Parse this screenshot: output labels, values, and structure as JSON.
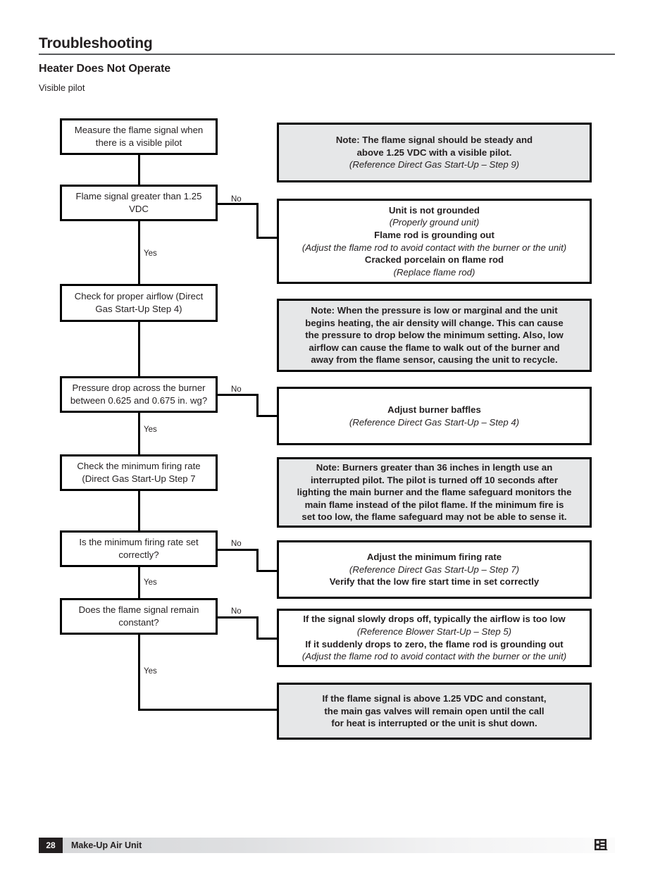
{
  "document": {
    "page_title": "Troubleshooting",
    "section_title": "Heater Does Not Operate",
    "section_subtitle": "Visible pilot"
  },
  "flowchart": {
    "type": "decision-flowchart",
    "edge_labels": {
      "yes": "Yes",
      "no": "No"
    },
    "left_nodes": [
      {
        "id": "measure-flame-signal",
        "kind": "process",
        "lines": [
          "Measure the flame signal",
          "when there is a visible pilot"
        ]
      },
      {
        "id": "flame-signal-greater",
        "kind": "decision",
        "lines": [
          "Flame signal greater",
          "than 1.25 VDC"
        ]
      },
      {
        "id": "check-proper-airflow",
        "kind": "process",
        "lines": [
          "Check for proper airflow",
          "(Direct Gas Start-Up Step 4)"
        ]
      },
      {
        "id": "pressure-drop-across-burner",
        "kind": "decision",
        "lines": [
          "Pressure drop across the burner",
          "between 0.625 and 0.675 in. wg?"
        ]
      },
      {
        "id": "check-minimum-firing-rate",
        "kind": "process",
        "lines": [
          "Check the minimum firing rate",
          "(Direct Gas Start-Up Step 7"
        ]
      },
      {
        "id": "is-minimum-firing-rate-set",
        "kind": "decision",
        "lines": [
          "Is the minimum firing rate",
          "set correctly?"
        ]
      },
      {
        "id": "does-flame-signal-remain-constant",
        "kind": "decision",
        "lines": [
          "Does the flame signal",
          "remain constant?"
        ]
      }
    ],
    "right_nodes": [
      {
        "id": "note-flame-signal-steady",
        "style": "note",
        "lines": [
          {
            "text": "Note: The flame signal should be steady and",
            "emphasis": "bold"
          },
          {
            "text": "above 1.25 VDC with a visible pilot.",
            "emphasis": "bold"
          },
          {
            "text": "(Reference Direct Gas Start-Up – Step 9)",
            "emphasis": "italic"
          }
        ]
      },
      {
        "id": "action-grounding-causes",
        "style": "action",
        "lines": [
          {
            "text": "Unit is not grounded",
            "emphasis": "bold"
          },
          {
            "text": "(Properly ground unit)",
            "emphasis": "italic"
          },
          {
            "text": "Flame rod is grounding out",
            "emphasis": "bold"
          },
          {
            "text": "(Adjust the flame rod to avoid contact with the burner or the unit)",
            "emphasis": "italic"
          },
          {
            "text": "Cracked porcelain on flame rod",
            "emphasis": "bold"
          },
          {
            "text": "(Replace flame rod)",
            "emphasis": "italic"
          }
        ]
      },
      {
        "id": "note-pressure-low-marginal",
        "style": "note",
        "lines": [
          {
            "text": "Note: When the pressure is low or marginal and the unit",
            "emphasis": "bold"
          },
          {
            "text": "begins heating, the air density will change. This can cause",
            "emphasis": "bold"
          },
          {
            "text": "the pressure to drop below the minimum setting. Also, low",
            "emphasis": "bold"
          },
          {
            "text": "airflow can cause the flame to walk out of the burner and",
            "emphasis": "bold"
          },
          {
            "text": "away from the flame sensor, causing the unit to recycle.",
            "emphasis": "bold"
          }
        ]
      },
      {
        "id": "action-adjust-burner-baffles",
        "style": "action",
        "lines": [
          {
            "text": "Adjust burner baffles",
            "emphasis": "bold"
          },
          {
            "text": "(Reference Direct Gas Start-Up – Step 4)",
            "emphasis": "italic"
          }
        ]
      },
      {
        "id": "note-burners-greater-36-inches",
        "style": "note",
        "lines": [
          {
            "text": "Note: Burners greater than 36 inches in length use an",
            "emphasis": "bold"
          },
          {
            "text": "interrupted pilot. The pilot is turned off 10 seconds after",
            "emphasis": "bold"
          },
          {
            "text": "lighting the main burner and the flame safeguard monitors the",
            "emphasis": "bold"
          },
          {
            "text": "main flame instead of the pilot flame. If the minimum fire is",
            "emphasis": "bold"
          },
          {
            "text": "set too low, the flame safeguard may not be able to sense it.",
            "emphasis": "bold"
          }
        ]
      },
      {
        "id": "action-adjust-minimum-firing-rate",
        "style": "action",
        "lines": [
          {
            "text": "Adjust the minimum firing rate",
            "emphasis": "bold"
          },
          {
            "text": "(Reference Direct Gas Start-Up – Step 7)",
            "emphasis": "italic"
          },
          {
            "text": "Verify that the low fire start time in set correctly",
            "emphasis": "bold"
          }
        ]
      },
      {
        "id": "action-signal-drop-diagnosis",
        "style": "action",
        "lines": [
          {
            "text": "If the signal slowly drops off, typically the airflow is too low",
            "emphasis": "bold"
          },
          {
            "text": "(Reference Blower Start-Up – Step 5)",
            "emphasis": "italic"
          },
          {
            "text": "If it suddenly drops to zero, the flame rod is grounding out",
            "emphasis": "bold"
          },
          {
            "text": "(Adjust the flame rod to avoid contact with the burner or the unit)",
            "emphasis": "italic"
          }
        ]
      },
      {
        "id": "note-final-outcome",
        "style": "note",
        "lines": [
          {
            "text": "If the flame signal is above 1.25 VDC and constant,",
            "emphasis": "bold"
          },
          {
            "text": "the main gas valves will remain open until the call",
            "emphasis": "bold"
          },
          {
            "text": "for heat is interrupted or the unit is shut down.",
            "emphasis": "bold"
          }
        ]
      }
    ]
  },
  "footer": {
    "page_number": "28",
    "document_name": "Make-Up Air Unit",
    "logo": "greenheck-logo-icon"
  },
  "colors": {
    "text": "#231f20",
    "note_background": "#e6e7e8",
    "border": "#000000",
    "rule": "#58595b"
  }
}
